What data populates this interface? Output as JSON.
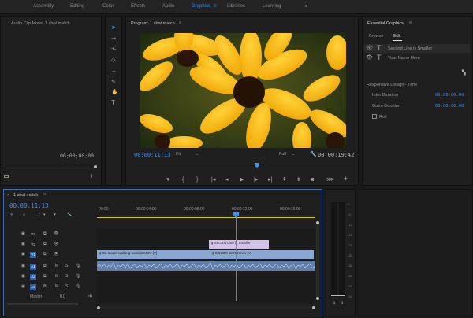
{
  "workspace": {
    "tabs": [
      {
        "label": "Assembly"
      },
      {
        "label": "Editing"
      },
      {
        "label": "Color"
      },
      {
        "label": "Effects"
      },
      {
        "label": "Audio"
      },
      {
        "label": "Graphics"
      },
      {
        "label": "Libraries"
      },
      {
        "label": "Learning"
      }
    ],
    "active": "Graphics",
    "more": "»"
  },
  "source": {
    "title": "Audio Clip Mixer: 1 shot match",
    "timecode": "00;00;00;00"
  },
  "program": {
    "title": "Program: 1 shot match",
    "menu_icon": "≡",
    "timecode_left": "00:00:11:13",
    "fit": "Fit",
    "quality": "Full",
    "timecode_right": "00:00:19:42"
  },
  "essential": {
    "title": "Essential Graphics",
    "tabs": [
      {
        "label": "Browse"
      },
      {
        "label": "Edit"
      }
    ],
    "layers": [
      {
        "label": "Second Line is Smaller"
      },
      {
        "label": "Your Name Here"
      }
    ],
    "responsive_title": "Responsive Design - Time",
    "intro_label": "Intro Duration",
    "intro_value": "00:00:00:00",
    "outro_label": "Outro Duration",
    "outro_value": "00:00:00:00",
    "roll_label": "Roll"
  },
  "timeline": {
    "title": "1 shot match",
    "timecode": "00:00:11:13",
    "ruler": [
      "00:00",
      "00:00:04:00",
      "00:00:08:00",
      "00:00:12:00",
      "00:00:16:00"
    ],
    "tracks": [
      {
        "label": "V3",
        "type": "video"
      },
      {
        "label": "V2",
        "type": "video"
      },
      {
        "label": "V1",
        "type": "video"
      },
      {
        "label": "A1",
        "type": "audio"
      },
      {
        "label": "A2",
        "type": "audio"
      },
      {
        "label": "A3",
        "type": "audio"
      }
    ],
    "master_label": "Master",
    "master_value": "0.0",
    "clips": {
      "graphic": "Second Line is Smaller",
      "video1": "Cu model walking outside.MOV [V]",
      "video2": "COLOR WORKmov [V]"
    }
  },
  "meter": {
    "scale": [
      "0",
      "-6",
      "-12",
      "-18",
      "-24",
      "-30",
      "-36",
      "-42",
      "-48",
      "-54"
    ],
    "solo": [
      "S",
      "S"
    ]
  },
  "colors": {
    "accent": "#3d8ef0",
    "video_clip": "#8aa6d4",
    "graphic_clip": "#d2c2e8",
    "playhead": "#3d8ef0"
  }
}
